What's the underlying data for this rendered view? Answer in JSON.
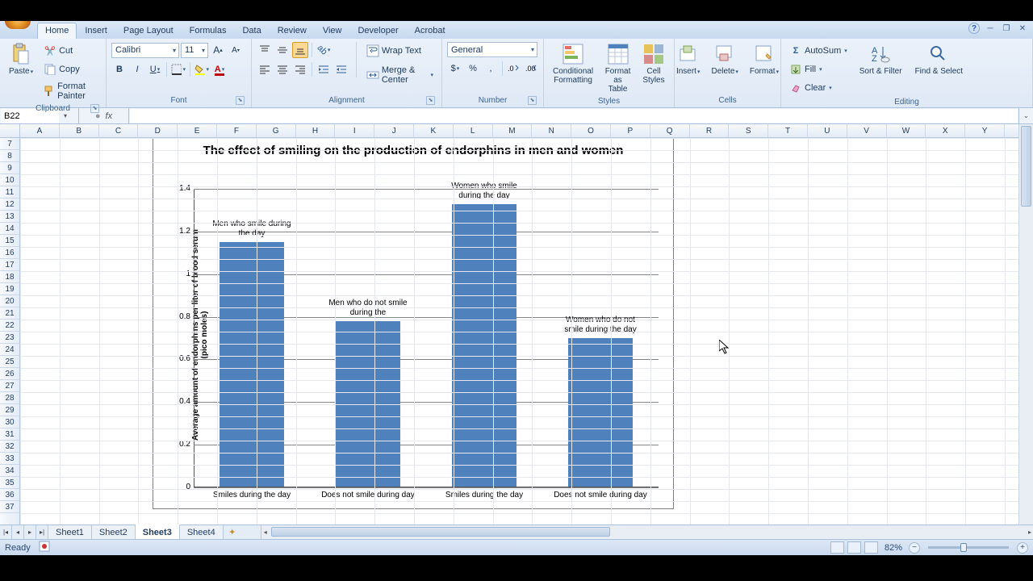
{
  "tabs": {
    "items": [
      "Home",
      "Insert",
      "Page Layout",
      "Formulas",
      "Data",
      "Review",
      "View",
      "Developer",
      "Acrobat"
    ],
    "active": 0
  },
  "ribbon": {
    "clipboard": {
      "label": "Clipboard",
      "paste": "Paste",
      "cut": "Cut",
      "copy": "Copy",
      "painter": "Format Painter"
    },
    "font": {
      "label": "Font",
      "name": "Calibri",
      "size": "11"
    },
    "alignment": {
      "label": "Alignment",
      "wrap": "Wrap Text",
      "merge": "Merge & Center"
    },
    "number": {
      "label": "Number",
      "format": "General"
    },
    "styles": {
      "label": "Styles",
      "cond": "Conditional\nFormatting",
      "table": "Format\nas Table",
      "cell": "Cell\nStyles"
    },
    "cells": {
      "label": "Cells",
      "insert": "Insert",
      "delete": "Delete",
      "format": "Format"
    },
    "editing": {
      "label": "Editing",
      "sum": "AutoSum",
      "fill": "Fill",
      "clear": "Clear",
      "sort": "Sort &\nFilter",
      "find": "Find &\nSelect"
    }
  },
  "namebox": "B22",
  "columns": [
    "A",
    "B",
    "C",
    "D",
    "E",
    "F",
    "G",
    "H",
    "I",
    "J",
    "K",
    "L",
    "M",
    "N",
    "O",
    "P",
    "Q",
    "R",
    "S",
    "T",
    "U",
    "V",
    "W",
    "X",
    "Y"
  ],
  "rowStart": 7,
  "rowEnd": 37,
  "sheets": {
    "items": [
      "Sheet1",
      "Sheet2",
      "Sheet3",
      "Sheet4"
    ],
    "active": 2
  },
  "status": {
    "ready": "Ready",
    "zoom": "82%"
  },
  "chart_data": {
    "type": "bar",
    "title": "The effect of smiling on the production of endorphins in men and women",
    "ylabel": "Average amount of endorphins per liter of blood serum (pico moles)",
    "ylim": [
      0,
      1.4
    ],
    "yticks": [
      0,
      0.2,
      0.4,
      0.6,
      0.8,
      1,
      1.2,
      1.4
    ],
    "categories": [
      "Smiles during the day",
      "Does not smile during day",
      "Smiles during the day",
      "Does not smile during day"
    ],
    "values": [
      1.15,
      0.78,
      1.33,
      0.7
    ],
    "data_labels": [
      "Men who smile during the day",
      "Men who do not smile during the",
      "Women who smile during the day",
      "Women who do not smile during the day"
    ],
    "bar_color": "#4f81bd"
  }
}
